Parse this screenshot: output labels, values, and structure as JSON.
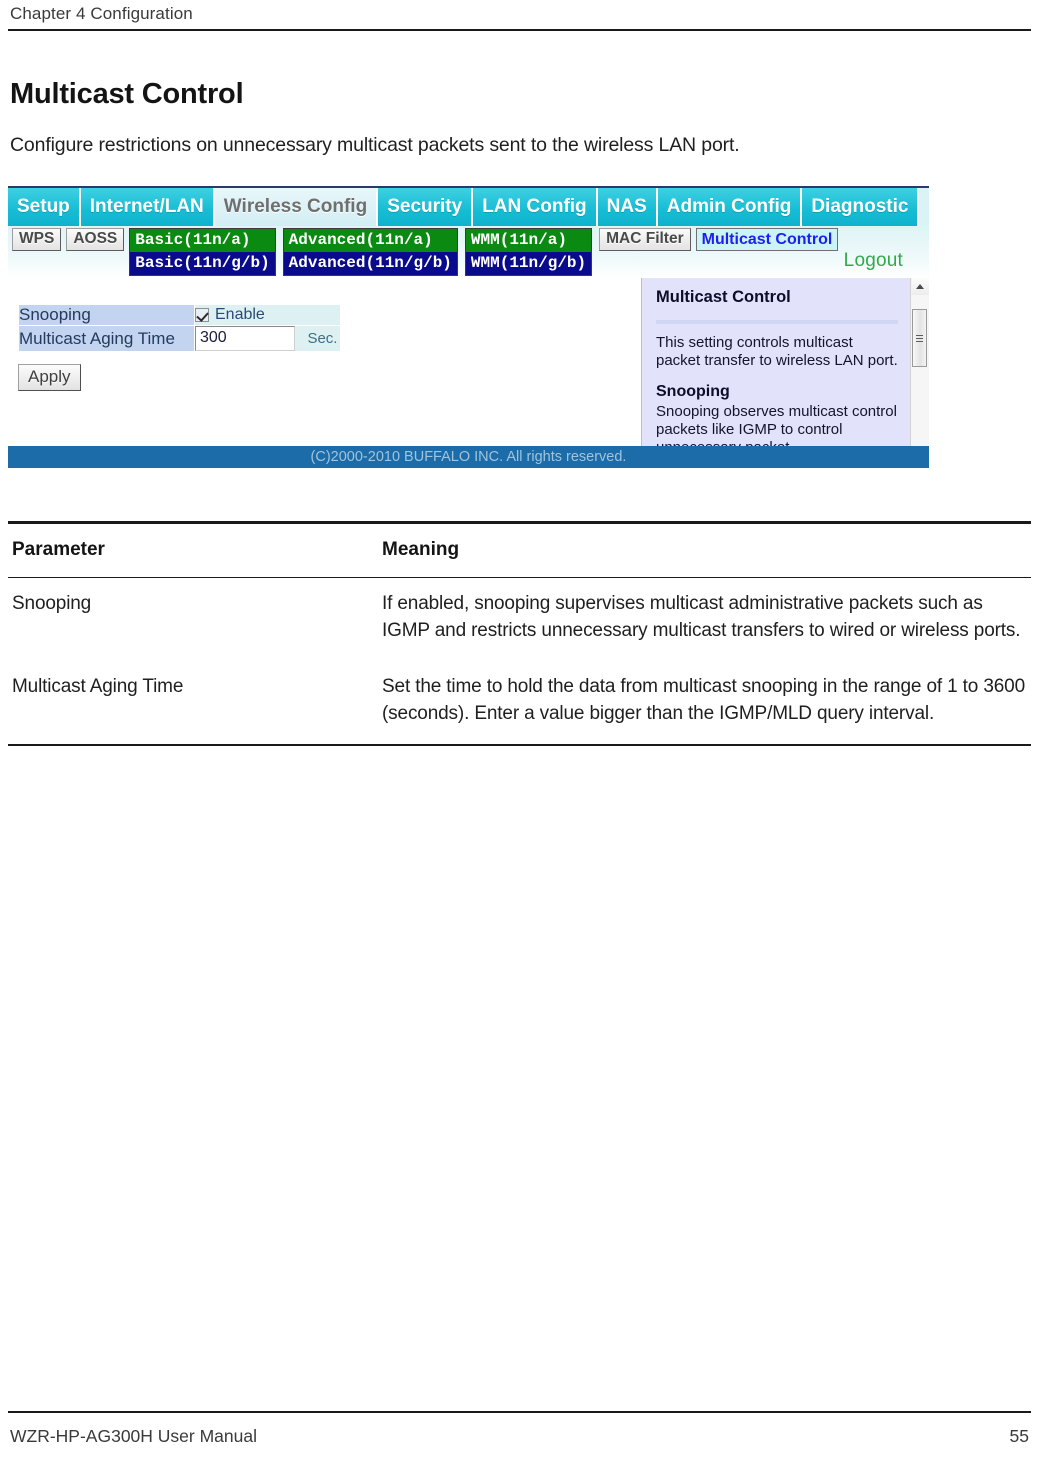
{
  "header": {
    "chapter": "Chapter 4  Configuration"
  },
  "title": "Multicast Control",
  "intro": "Configure restrictions on unnecessary multicast packets sent to the wireless LAN port.",
  "screenshot": {
    "main_tabs": [
      {
        "label": "Setup",
        "active": false
      },
      {
        "label": "Internet/LAN",
        "active": false
      },
      {
        "label": "Wireless Config",
        "active": true
      },
      {
        "label": "Security",
        "active": false
      },
      {
        "label": "LAN Config",
        "active": false
      },
      {
        "label": "NAS",
        "active": false
      },
      {
        "label": "Admin Config",
        "active": false
      },
      {
        "label": "Diagnostic",
        "active": false
      }
    ],
    "sub_buttons": [
      {
        "label": "WPS"
      },
      {
        "label": "AOSS"
      }
    ],
    "band_groups": [
      {
        "a": "Basic(11n/a)",
        "gb": "Basic(11n/g/b)"
      },
      {
        "a": "Advanced(11n/a)",
        "gb": "Advanced(11n/g/b)"
      },
      {
        "a": "WMM(11n/a)",
        "gb": "WMM(11n/g/b)"
      }
    ],
    "mac_filter": "MAC Filter",
    "multicast_tab": "Multicast Control",
    "logout": "Logout",
    "form": {
      "rows": [
        {
          "label": "Snooping",
          "type": "checkbox",
          "checked": true,
          "value_label": "Enable"
        },
        {
          "label": "Multicast Aging Time",
          "type": "text",
          "value": "300",
          "unit": "Sec."
        }
      ],
      "apply": "Apply"
    },
    "help": {
      "heading": "Multicast Control",
      "paragraph1": "This setting controls multicast packet transfer to wireless LAN port.",
      "subheading": "Snooping",
      "paragraph2": "Snooping observes multicast control packets like IGMP to control unnecessary packet"
    },
    "copyright": "(C)2000-2010 BUFFALO INC. All rights reserved.",
    "colors": {
      "tab_cyan": "#16bcd4",
      "band_green": "#0b8a12",
      "band_navy": "#0a0a8c",
      "help_bg": "#e2e2fb",
      "footer_blue": "#1b6ca8",
      "active_link": "#2020ee",
      "logout_green": "#2faa4b"
    }
  },
  "table": {
    "headers": {
      "parameter": "Parameter",
      "meaning": "Meaning"
    },
    "rows": [
      {
        "parameter": "Snooping",
        "meaning": "If enabled, snooping supervises multicast administrative packets such as IGMP and restricts unnecessary multicast transfers to wired or wireless ports."
      },
      {
        "parameter": "Multicast Aging Time",
        "meaning": "Set the time to hold the data from multicast snooping in the range of 1 to 3600 (seconds).  Enter a value bigger than the IGMP/MLD query interval."
      }
    ]
  },
  "footer": {
    "manual": "WZR-HP-AG300H User Manual",
    "page": "55"
  }
}
